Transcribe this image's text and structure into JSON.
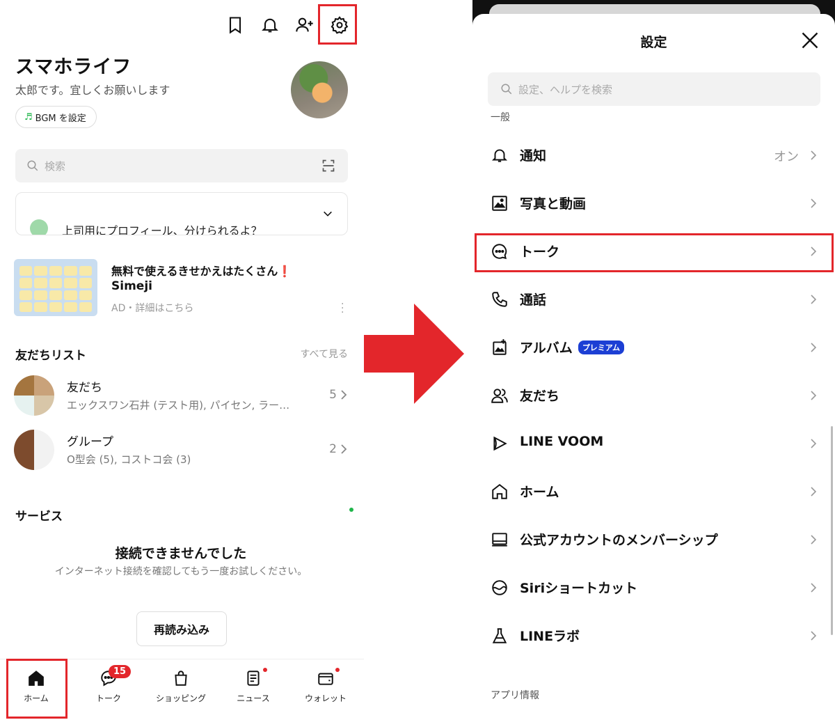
{
  "left": {
    "profile": {
      "name": "スマホライフ",
      "status": "太郎です。宜しくお願いします",
      "bgm_label": "BGM を設定"
    },
    "search_placeholder": "検索",
    "story_text": "上司用にプロフィール、分けられるよ？",
    "ad": {
      "title": "無料で使えるきせかえはたくさん",
      "title_mark": "❗",
      "name": "Simeji",
      "sub": "AD・詳細はこちら"
    },
    "friends_section": {
      "title": "友だちリスト",
      "see_all": "すべて見る",
      "rows": [
        {
          "name": "友だち",
          "sub": "エックスワン石井 (テスト用), パイセン, ラー…",
          "count": "5"
        },
        {
          "name": "グループ",
          "sub": "O型会 (5), コストコ会 (3)",
          "count": "2"
        }
      ]
    },
    "services": {
      "title": "サービス",
      "error_title": "接続できませんでした",
      "error_sub": "インターネット接続を確認してもう一度お試しください。",
      "reload_label": "再読み込み"
    },
    "tabs": [
      {
        "label": "ホーム",
        "icon": "home-icon"
      },
      {
        "label": "トーク",
        "icon": "chat-icon",
        "badge": "15"
      },
      {
        "label": "ショッピング",
        "icon": "shopping-bag-icon"
      },
      {
        "label": "ニュース",
        "icon": "news-icon"
      },
      {
        "label": "ウォレット",
        "icon": "wallet-icon"
      }
    ]
  },
  "right": {
    "title": "設定",
    "search_placeholder": "設定、ヘルプを検索",
    "group_general": "一般",
    "group_app": "アプリ情報",
    "rows": [
      {
        "label": "通知",
        "value": "オン",
        "icon": "bell-icon"
      },
      {
        "label": "写真と動画",
        "icon": "photo-icon"
      },
      {
        "label": "トーク",
        "icon": "chat-bubble-icon"
      },
      {
        "label": "通話",
        "icon": "phone-icon"
      },
      {
        "label": "アルバム",
        "badge": "プレミアム",
        "icon": "album-icon"
      },
      {
        "label": "友だち",
        "icon": "friends-icon"
      },
      {
        "label": "LINE VOOM",
        "icon": "voom-icon"
      },
      {
        "label": "ホーム",
        "icon": "home-icon"
      },
      {
        "label": "公式アカウントのメンバーシップ",
        "icon": "membership-icon"
      },
      {
        "label": "Siriショートカット",
        "icon": "siri-icon"
      },
      {
        "label": "LINEラボ",
        "icon": "flask-icon"
      }
    ]
  },
  "colors": {
    "highlight_red": "#e3262b",
    "line_green": "#1fb54a",
    "premium_blue": "#1c3fd4"
  }
}
